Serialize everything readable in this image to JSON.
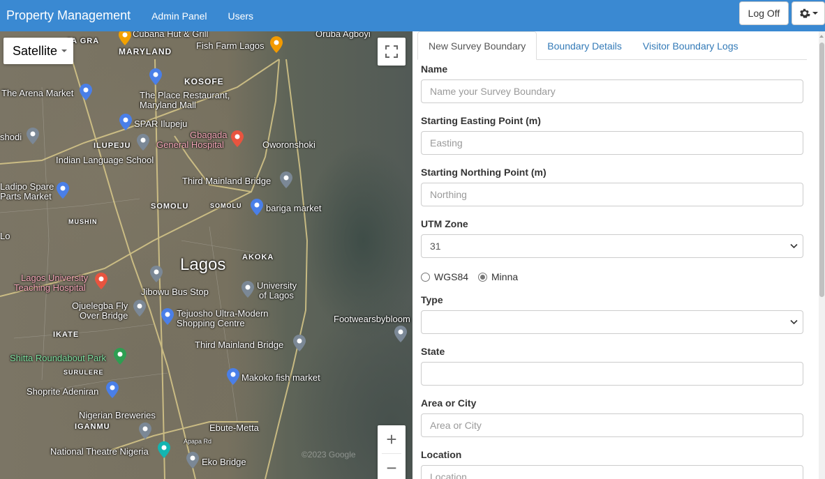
{
  "navbar": {
    "brand": "Property Management",
    "links": [
      "Admin Panel",
      "Users"
    ],
    "logoff_label": "Log Off",
    "settings_icon": "gear-icon"
  },
  "map": {
    "map_type": "Satellite",
    "fullscreen_icon": "fullscreen-icon",
    "zoom_in": "+",
    "zoom_out": "−",
    "labels": {
      "cubana": "Cubana Hut & Grill",
      "oruba": "Oruba Agboyi",
      "maryland": "MARYLAND",
      "fish_farm": "Fish Farm Lagos",
      "jagra": "JA GRA",
      "kosofe": "KOSOFE",
      "arena": "The Arena Market",
      "place_rest_1": "The Place Restaurant,",
      "place_rest_2": "Maryland Mall",
      "spar": "SPAR Ilupeju",
      "shodi": "shodi",
      "gbagada": "Gbagada",
      "general_hospital": "General Hospital",
      "ilupeju": "ILUPEJU",
      "oworonshoki": "Oworonshoki",
      "indian_school": "Indian Language School",
      "third_mainland_1": "Third Mainland Bridge",
      "ladipo_1": "Ladipo Spare",
      "ladipo_2": "Parts Market",
      "somolu": "SOMOLU",
      "somolu_small": "SOMOLU",
      "bariga": "bariga market",
      "mushin": "MUSHIN",
      "lo": "Lo",
      "akoka": "AKOKA",
      "lagos": "Lagos",
      "unilag_hosp_1": "Lagos University",
      "unilag_hosp_2": "Teaching Hospital",
      "jibowu": "Jibowu Bus Stop",
      "unilag_1": "University",
      "unilag_2": "of Lagos",
      "ojuelegba_1": "Ojuelegba Fly",
      "ojuelegba_2": "Over Bridge",
      "tejuosho_1": "Tejuosho Ultra-Modern",
      "tejuosho_2": "Shopping Centre",
      "footwears": "Footwearsbybloom",
      "ikate": "IKATE",
      "third_mainland_2": "Third Mainland Bridge",
      "shitta": "Shitta Roundabout Park",
      "surulere": "SURULERE",
      "makoko": "Makoko fish market",
      "shoprite": "Shoprite Adeniran",
      "breweries": "Nigerian Breweries",
      "iganmu": "IGANMU",
      "ebute": "Ebute-Metta",
      "apapa": "Apapa Rd",
      "theatre": "National Theatre Nigeria",
      "eko": "Eko Bridge",
      "copyright": "©2023 Google"
    }
  },
  "panel": {
    "tabs": [
      "New Survey Boundary",
      "Boundary Details",
      "Visitor Boundary Logs"
    ],
    "fields": {
      "name_label": "Name",
      "name_placeholder": "Name your Survey Boundary",
      "easting_label": "Starting Easting Point (m)",
      "easting_placeholder": "Easting",
      "northing_label": "Starting Northing Point (m)",
      "northing_placeholder": "Northing",
      "utm_label": "UTM Zone",
      "utm_value": "31",
      "datum_options": [
        "WGS84",
        "Minna"
      ],
      "datum_selected": "Minna",
      "type_label": "Type",
      "type_value": "",
      "state_label": "State",
      "state_value": "",
      "area_label": "Area or City",
      "area_placeholder": "Area or City",
      "location_label": "Location",
      "location_placeholder": "Location"
    }
  },
  "colors": {
    "navbar": "#3a89d2",
    "link": "#337ab7"
  }
}
